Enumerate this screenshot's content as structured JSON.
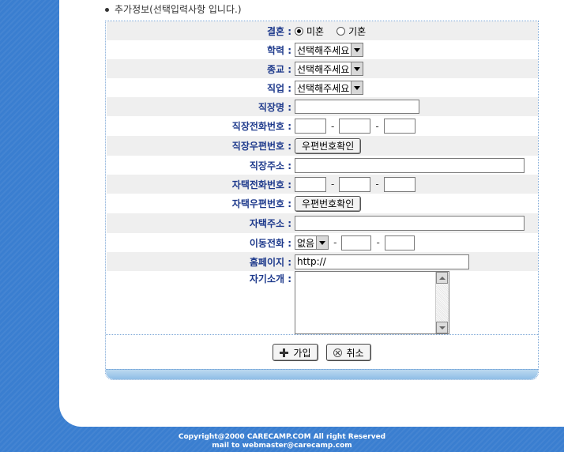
{
  "section_title": "추가정보(선택입력사항 입니다.)",
  "marriage": {
    "label": "결혼 :",
    "options": [
      "미혼",
      "기혼"
    ],
    "selected": "미혼"
  },
  "education": {
    "label": "학력 :",
    "value": "선택해주세요"
  },
  "religion": {
    "label": "종교 :",
    "value": "선택해주세요"
  },
  "job": {
    "label": "직업 :",
    "value": "선택해주세요"
  },
  "company_name": {
    "label": "직장명 :"
  },
  "work_phone": {
    "label": "직장전화번호 :",
    "dash": "-"
  },
  "work_zip": {
    "label": "직장우편번호 :",
    "button": "우편번호확인"
  },
  "work_address": {
    "label": "직장주소 :"
  },
  "home_phone": {
    "label": "자택전화번호 :",
    "dash": "-"
  },
  "home_zip": {
    "label": "자택우편번호 :",
    "button": "우편번호확인"
  },
  "home_address": {
    "label": "자택주소 :"
  },
  "mobile": {
    "label": "이동전화 :",
    "prefix": "없음",
    "dash": "-"
  },
  "homepage": {
    "label": "홈페이지 :",
    "value": "http://"
  },
  "intro": {
    "label": "자기소개 :"
  },
  "actions": {
    "join": "가입",
    "cancel": "취소"
  },
  "footer": {
    "line1": "Copyright@2000 CARECAMP.COM All right Reserved",
    "line2": "mail to webmaster@carecamp.com"
  }
}
